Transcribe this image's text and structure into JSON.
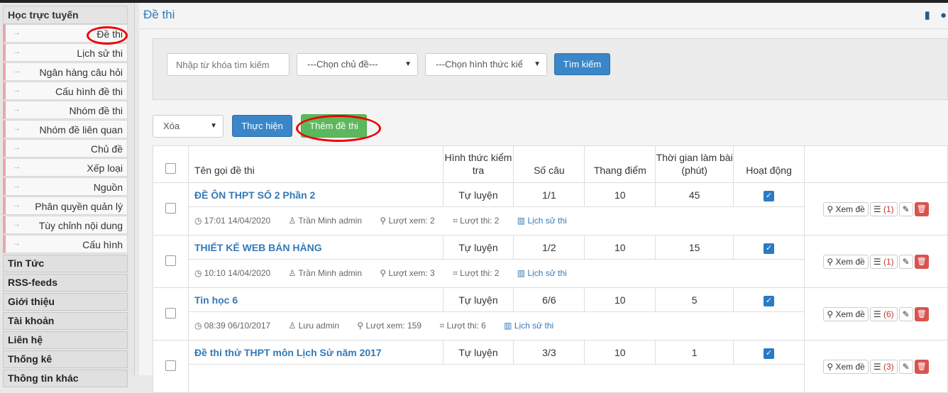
{
  "sidebar": {
    "online_learning": "Học trực tuyến",
    "items": [
      {
        "label": "Đề thi"
      },
      {
        "label": "Lịch sử thi"
      },
      {
        "label": "Ngân hàng câu hỏi"
      },
      {
        "label": "Cấu hình đề thi"
      },
      {
        "label": "Nhóm đề thi"
      },
      {
        "label": "Nhóm đề liên quan"
      },
      {
        "label": "Chủ đề"
      },
      {
        "label": "Xếp loại"
      },
      {
        "label": "Nguồn"
      },
      {
        "label": "Phân quyền quản lý"
      },
      {
        "label": "Tùy chỉnh nội dung"
      },
      {
        "label": "Cấu hình"
      }
    ],
    "sections": [
      {
        "label": "Tin Tức"
      },
      {
        "label": "RSS-feeds"
      },
      {
        "label": "Giới thiệu"
      },
      {
        "label": "Tài khoản"
      },
      {
        "label": "Liên hệ"
      },
      {
        "label": "Thống kê"
      },
      {
        "label": "Thông tin khác"
      }
    ]
  },
  "header": {
    "title": "Đề thi"
  },
  "filter": {
    "search_placeholder": "Nhập từ khóa tìm kiếm",
    "topic_select": "---Chọn chủ đề---",
    "form_select": "---Chọn hình thức kiể",
    "search_button": "Tìm kiếm"
  },
  "bulk": {
    "action_select": "Xóa",
    "execute_button": "Thực hiện",
    "add_button": "Thêm đề thi"
  },
  "table": {
    "headers": {
      "name": "Tên gọi đề thi",
      "form": "Hình thức kiểm tra",
      "questions": "Số câu",
      "scale": "Thang điểm",
      "time": "Thời gian làm bài (phút)",
      "active": "Hoạt động"
    },
    "rows": [
      {
        "name": "ĐỀ ÔN THPT SỐ 2 Phần 2",
        "form": "Tự luyện",
        "questions": "1/1",
        "scale": "10",
        "time": "45",
        "datetime": "17:01 14/04/2020",
        "author": "Trần Minh admin",
        "views": "Lượt xem: 2",
        "attempts": "Lượt thi: 2",
        "history": "Lịch sử thi",
        "count": "(1)"
      },
      {
        "name": "THIẾT KẾ WEB BÁN HÀNG",
        "form": "Tự luyện",
        "questions": "1/2",
        "scale": "10",
        "time": "15",
        "datetime": "10:10 14/04/2020",
        "author": "Trần Minh admin",
        "views": "Lượt xem: 3",
        "attempts": "Lượt thi: 2",
        "history": "Lịch sử thi",
        "count": "(1)"
      },
      {
        "name": "Tin học 6",
        "form": "Tự luyện",
        "questions": "6/6",
        "scale": "10",
        "time": "5",
        "datetime": "08:39 06/10/2017",
        "author": "Lưu admin",
        "views": "Lượt xem: 159",
        "attempts": "Lượt thi: 6",
        "history": "Lịch sử thi",
        "count": "(6)"
      },
      {
        "name": "Đề thi thử THPT môn Lịch Sử năm 2017",
        "form": "Tự luyện",
        "questions": "3/3",
        "scale": "10",
        "time": "1",
        "datetime": "",
        "author": "",
        "views": "",
        "attempts": "",
        "history": "",
        "count": "(3)"
      }
    ],
    "view_label": "Xem đề"
  },
  "colors": {
    "link": "#337ab7",
    "primary": "#3a86c8",
    "success": "#5cb85c",
    "danger": "#d9534f",
    "highlight": "#e00000"
  }
}
